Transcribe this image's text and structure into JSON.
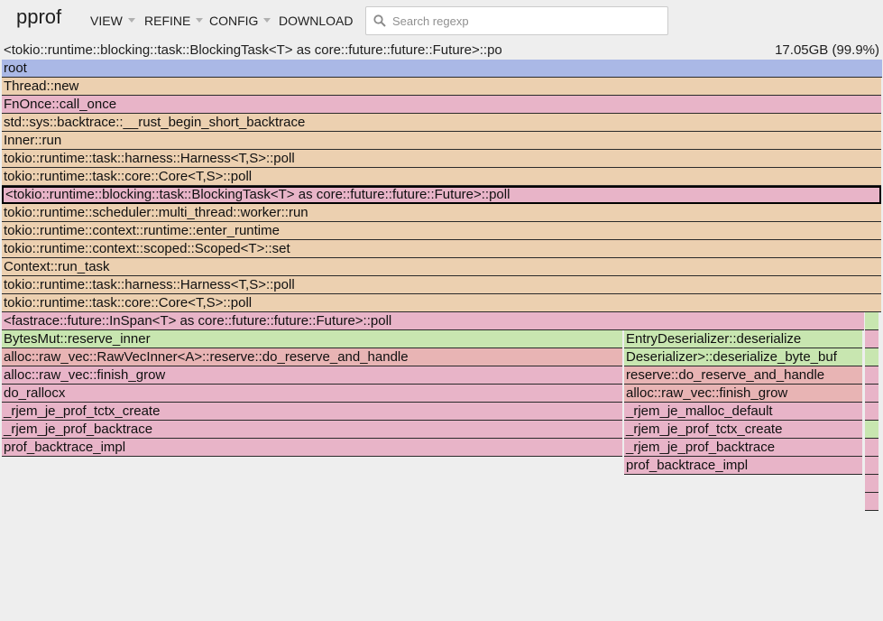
{
  "app": {
    "name": "pprof"
  },
  "menu": {
    "view": "VIEW",
    "refine": "REFINE",
    "config": "CONFIG",
    "download": "DOWNLOAD"
  },
  "search": {
    "placeholder": "Search regexp",
    "value": ""
  },
  "details": {
    "name": "<tokio::runtime::blocking::task::BlockingTask<T> as core::future::future::Future>::po",
    "value": "17.05GB (99.9%)"
  },
  "colors": {
    "root": "#aab8e6",
    "tan": "#ecd0b0",
    "pink": "#e8b4c8",
    "green": "#c8e6b0",
    "salmon": "#e8b4b4"
  },
  "flame": {
    "frames": [
      {
        "label": "root",
        "depth": 0,
        "start": 0.0,
        "width": 1.0,
        "color": "root"
      },
      {
        "label": "Thread::new",
        "depth": 1,
        "start": 0.0,
        "width": 0.999,
        "color": "tan"
      },
      {
        "label": "FnOnce::call_once",
        "depth": 2,
        "start": 0.0,
        "width": 0.999,
        "color": "pink"
      },
      {
        "label": "std::sys::backtrace::__rust_begin_short_backtrace",
        "depth": 3,
        "start": 0.0,
        "width": 0.999,
        "color": "tan"
      },
      {
        "label": "Inner::run",
        "depth": 4,
        "start": 0.0,
        "width": 0.999,
        "color": "tan"
      },
      {
        "label": "tokio::runtime::task::harness::Harness<T,S>::poll",
        "depth": 5,
        "start": 0.0,
        "width": 0.999,
        "color": "tan"
      },
      {
        "label": "tokio::runtime::task::core::Core<T,S>::poll",
        "depth": 6,
        "start": 0.0,
        "width": 0.999,
        "color": "tan"
      },
      {
        "label": "<tokio::runtime::blocking::task::BlockingTask<T> as core::future::future::Future>::poll",
        "depth": 7,
        "start": 0.0,
        "width": 0.999,
        "color": "pink",
        "selected": true
      },
      {
        "label": "tokio::runtime::scheduler::multi_thread::worker::run",
        "depth": 8,
        "start": 0.0,
        "width": 0.999,
        "color": "tan"
      },
      {
        "label": "tokio::runtime::context::runtime::enter_runtime",
        "depth": 9,
        "start": 0.0,
        "width": 0.999,
        "color": "tan"
      },
      {
        "label": "tokio::runtime::context::scoped::Scoped<T>::set",
        "depth": 10,
        "start": 0.0,
        "width": 0.999,
        "color": "tan"
      },
      {
        "label": "Context::run_task",
        "depth": 11,
        "start": 0.0,
        "width": 0.999,
        "color": "tan"
      },
      {
        "label": "tokio::runtime::task::harness::Harness<T,S>::poll",
        "depth": 12,
        "start": 0.0,
        "width": 0.999,
        "color": "tan"
      },
      {
        "label": "tokio::runtime::task::core::Core<T,S>::poll",
        "depth": 13,
        "start": 0.0,
        "width": 0.999,
        "color": "tan"
      },
      {
        "label": "<fastrace::future::InSpan<T> as core::future::future::Future>::poll",
        "depth": 14,
        "start": 0.0,
        "width": 0.979,
        "color": "pink"
      },
      {
        "label": "",
        "depth": 14,
        "start": 0.981,
        "width": 0.015,
        "color": "green"
      },
      {
        "label": "BytesMut::reserve_inner",
        "depth": 15,
        "start": 0.0,
        "width": 0.705,
        "color": "green"
      },
      {
        "label": "EntryDeserializer::deserialize",
        "depth": 15,
        "start": 0.707,
        "width": 0.271,
        "color": "green"
      },
      {
        "label": "",
        "depth": 15,
        "start": 0.981,
        "width": 0.015,
        "color": "pink"
      },
      {
        "label": "alloc::raw_vec::RawVecInner<A>::reserve::do_reserve_and_handle",
        "depth": 16,
        "start": 0.0,
        "width": 0.705,
        "color": "salmon"
      },
      {
        "label": "Deserializer>::deserialize_byte_buf",
        "depth": 16,
        "start": 0.707,
        "width": 0.271,
        "color": "green"
      },
      {
        "label": "",
        "depth": 16,
        "start": 0.981,
        "width": 0.015,
        "color": "green"
      },
      {
        "label": "alloc::raw_vec::finish_grow",
        "depth": 17,
        "start": 0.0,
        "width": 0.705,
        "color": "pink"
      },
      {
        "label": "reserve::do_reserve_and_handle",
        "depth": 17,
        "start": 0.707,
        "width": 0.271,
        "color": "salmon"
      },
      {
        "label": "",
        "depth": 17,
        "start": 0.981,
        "width": 0.015,
        "color": "pink"
      },
      {
        "label": "do_rallocx",
        "depth": 18,
        "start": 0.0,
        "width": 0.705,
        "color": "pink"
      },
      {
        "label": "alloc::raw_vec::finish_grow",
        "depth": 18,
        "start": 0.707,
        "width": 0.271,
        "color": "salmon"
      },
      {
        "label": "",
        "depth": 18,
        "start": 0.981,
        "width": 0.015,
        "color": "pink"
      },
      {
        "label": "_rjem_je_prof_tctx_create",
        "depth": 19,
        "start": 0.0,
        "width": 0.705,
        "color": "pink"
      },
      {
        "label": "_rjem_je_malloc_default",
        "depth": 19,
        "start": 0.707,
        "width": 0.271,
        "color": "pink"
      },
      {
        "label": "",
        "depth": 19,
        "start": 0.981,
        "width": 0.015,
        "color": "pink"
      },
      {
        "label": "_rjem_je_prof_backtrace",
        "depth": 20,
        "start": 0.0,
        "width": 0.705,
        "color": "pink"
      },
      {
        "label": "_rjem_je_prof_tctx_create",
        "depth": 20,
        "start": 0.707,
        "width": 0.271,
        "color": "pink"
      },
      {
        "label": "",
        "depth": 20,
        "start": 0.981,
        "width": 0.015,
        "color": "green"
      },
      {
        "label": "prof_backtrace_impl",
        "depth": 21,
        "start": 0.0,
        "width": 0.705,
        "color": "pink"
      },
      {
        "label": "_rjem_je_prof_backtrace",
        "depth": 21,
        "start": 0.707,
        "width": 0.271,
        "color": "pink"
      },
      {
        "label": "",
        "depth": 21,
        "start": 0.981,
        "width": 0.015,
        "color": "pink"
      },
      {
        "label": "prof_backtrace_impl",
        "depth": 22,
        "start": 0.707,
        "width": 0.271,
        "color": "pink"
      },
      {
        "label": "",
        "depth": 22,
        "start": 0.981,
        "width": 0.015,
        "color": "pink"
      },
      {
        "label": "",
        "depth": 23,
        "start": 0.981,
        "width": 0.015,
        "color": "pink"
      },
      {
        "label": "",
        "depth": 24,
        "start": 0.981,
        "width": 0.015,
        "color": "pink"
      }
    ]
  }
}
